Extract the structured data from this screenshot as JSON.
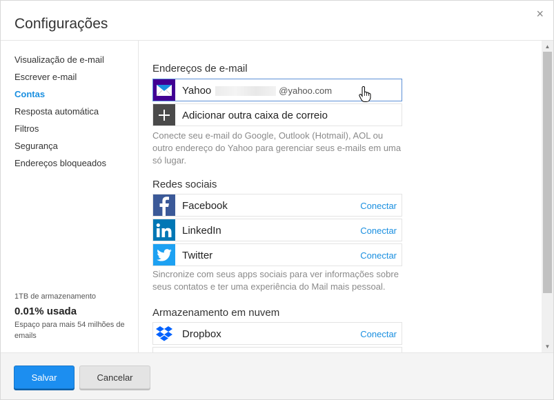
{
  "dialog": {
    "title": "Configurações",
    "close_symbol": "×"
  },
  "sidebar": {
    "items": [
      {
        "label": "Visualização de e-mail",
        "active": false
      },
      {
        "label": "Escrever e-mail",
        "active": false
      },
      {
        "label": "Contas",
        "active": true
      },
      {
        "label": "Resposta automática",
        "active": false
      },
      {
        "label": "Filtros",
        "active": false
      },
      {
        "label": "Segurança",
        "active": false
      },
      {
        "label": "Endereços bloqueados",
        "active": false
      }
    ],
    "storage": {
      "capacity": "1TB de armazenamento",
      "used": "0.01% usada",
      "remaining": "Espaço para mais 54 milhões de emails"
    }
  },
  "main": {
    "email_section": {
      "title": "Endereços de e-mail",
      "yahoo_label": "Yahoo",
      "yahoo_domain": "@yahoo.com",
      "add_mailbox_label": "Adicionar outra caixa de correio",
      "helper": "Conecte seu e-mail do Google, Outlook (Hotmail), AOL ou outro endereço do Yahoo para gerenciar seus e-mails em uma só lugar."
    },
    "social_section": {
      "title": "Redes sociais",
      "items": [
        {
          "label": "Facebook",
          "action": "Conectar",
          "icon": "facebook-icon",
          "color": "#3b5998"
        },
        {
          "label": "LinkedIn",
          "action": "Conectar",
          "icon": "linkedin-icon",
          "color": "#0077b5"
        },
        {
          "label": "Twitter",
          "action": "Conectar",
          "icon": "twitter-icon",
          "color": "#1da1f2"
        }
      ],
      "helper": "Sincronize com seus apps sociais para ver informações sobre seus contatos e ter uma experiência do Mail mais pessoal."
    },
    "cloud_section": {
      "title": "Armazenamento em nuvem",
      "items": [
        {
          "label": "Dropbox",
          "action": "Conectar",
          "icon": "dropbox-icon",
          "color": "#0061fe"
        }
      ]
    }
  },
  "footer": {
    "save_label": "Salvar",
    "cancel_label": "Cancelar"
  },
  "colors": {
    "accent": "#1a8fe0",
    "yahoo_purple": "#410093",
    "save_button": "#1c8ef0"
  }
}
